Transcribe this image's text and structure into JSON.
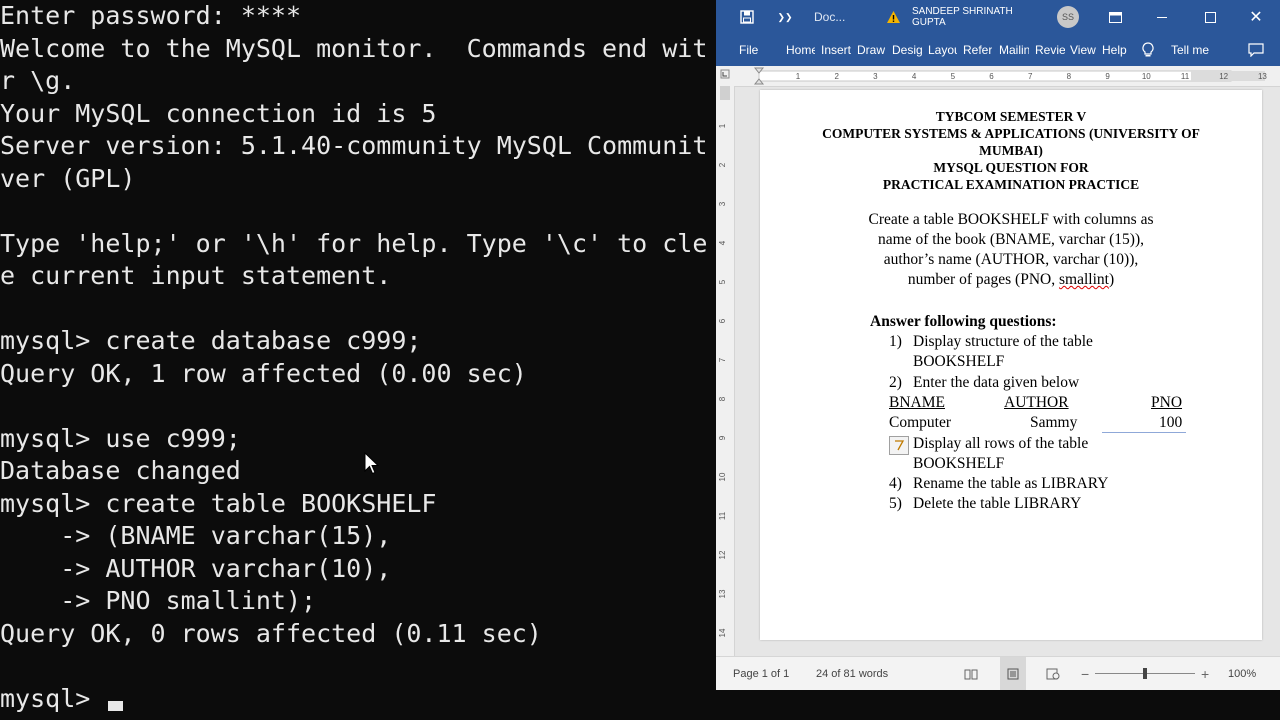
{
  "terminal": {
    "lines": [
      "Enter password: ****",
      "Welcome to the MySQL monitor.  Commands end wit",
      "r \\g.",
      "Your MySQL connection id is 5",
      "Server version: 5.1.40-community MySQL Communit",
      "ver (GPL)",
      "",
      "Type 'help;' or '\\h' for help. Type '\\c' to cle",
      "e current input statement.",
      "",
      "mysql> create database c999;",
      "Query OK, 1 row affected (0.00 sec)",
      "",
      "mysql> use c999;",
      "Database changed",
      "mysql> create table BOOKSHELF",
      "    -> (BNAME varchar(15),",
      "    -> AUTHOR varchar(10),",
      "    -> PNO smallint);",
      "Query OK, 0 rows affected (0.11 sec)",
      "",
      "mysql> "
    ]
  },
  "word": {
    "title": "Doc...",
    "user_name": "SANDEEP SHRINATH GUPTA",
    "user_initials": "SS",
    "tabs": [
      "File",
      "Home",
      "Insert",
      "Draw",
      "Design",
      "Layout",
      "References",
      "Mailings",
      "Review",
      "View",
      "Help"
    ],
    "tell_me": "Tell me",
    "ruler_numbers": [
      "1",
      "2",
      "3",
      "4",
      "5",
      "6",
      "7",
      "8",
      "9",
      "10",
      "11",
      "12",
      "13"
    ],
    "vruler_numbers": [
      "1",
      "2",
      "3",
      "4",
      "5",
      "6",
      "7",
      "8",
      "9",
      "10",
      "11",
      "12",
      "13",
      "14"
    ],
    "document": {
      "heading_lines": [
        "TYBCOM SEMESTER V",
        "COMPUTER SYSTEMS & APPLICATIONS (UNIVERSITY OF",
        "MUMBAI)",
        "MYSQL QUESTION FOR",
        "PRACTICAL EXAMINATION PRACTICE"
      ],
      "intro_lines": [
        "Create a table BOOKSHELF with columns as",
        "name of the book (BNAME, varchar (15)),",
        "author’s name (AUTHOR, varchar (10)),",
        "number of pages (PNO, "
      ],
      "intro_misspelled": "smallint",
      "intro_tail": ")",
      "answer_heading": "Answer following questions:",
      "q1_num": "1)",
      "q1_lines": [
        "Display structure of the table",
        "BOOKSHELF"
      ],
      "q2_num": "2)",
      "q2_text": "Enter the data given below",
      "table_headers": [
        "BNAME",
        "AUTHOR",
        "PNO"
      ],
      "table_row": [
        "Computer",
        "Sammy",
        "100"
      ],
      "q3_lines": [
        "Display all rows of the table",
        "BOOKSHELF"
      ],
      "q4_num": "4)",
      "q4_text": "Rename the table as LIBRARY",
      "q5_num": "5)",
      "q5_text": "Delete the table LIBRARY"
    },
    "status": {
      "page": "Page 1 of 1",
      "words": "24 of 81 words",
      "zoom": "100%",
      "zoom_level_fraction": 0.5
    }
  },
  "colors": {
    "word_blue": "#2b579a",
    "terminal_bg": "#0c0c0c",
    "terminal_fg": "#e8e8e8"
  }
}
